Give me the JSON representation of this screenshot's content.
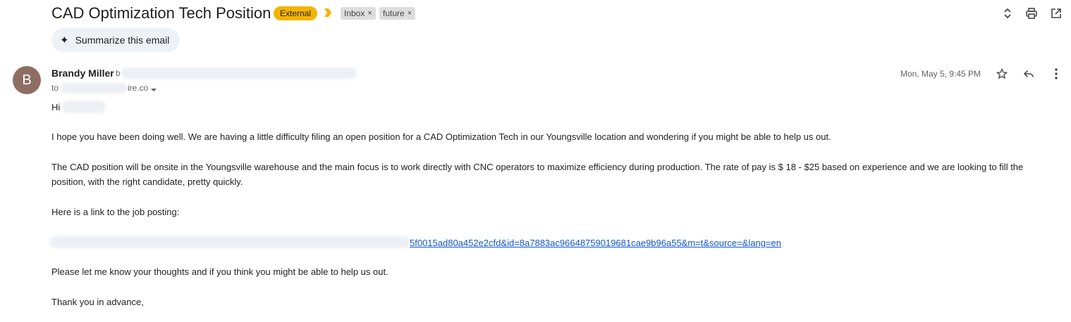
{
  "email": {
    "subject": "CAD Optimization Tech Position",
    "external_badge": "External",
    "labels": [
      {
        "name": "Inbox",
        "remove": "×"
      },
      {
        "name": "future",
        "remove": "×"
      }
    ],
    "summarize_label": "Summarize this email",
    "summarize_glyph": "✦",
    "sender": {
      "avatar_initial": "B",
      "name": "Brandy Miller",
      "email_visible": "b",
      "to_prefix": "to",
      "to_suffix": "ire.co"
    },
    "date": "Mon, May 5, 9:45 PM",
    "greeting": "Hi",
    "paragraphs": [
      "I hope you have been doing well.  We are having a little difficulty filing an open position for a CAD Optimization Tech in our Youngsville location and wondering if you might be able to help us out.",
      "The CAD position will be onsite in the Youngsville warehouse and the main focus is to work directly with CNC operators to maximize efficiency during production.  The rate of pay is $ 18 - $25 based on experience and we are looking to fill the position, with the right candidate, pretty quickly.",
      "Here is a link to the job posting:"
    ],
    "link_visible": "5f0015ad80a452e2cfd&id=8a7883ac96648759019681cae9b96a55&m=t&source=&lang=en",
    "closing_lines": [
      "Please let me know your thoughts and if you think you might be able to help us out.",
      "Thank you in advance,"
    ]
  },
  "colors": {
    "external_badge": "#f4b400",
    "avatar": "#8d6e63",
    "link": "#1155cc",
    "importance_marker": "#f4b400"
  },
  "icons": [
    "importance-marker-icon",
    "expand-collapse-icon",
    "print-icon",
    "open-in-new-window-icon",
    "sparkle-icon",
    "star-icon",
    "reply-icon",
    "more-vert-icon",
    "dropdown-caret-icon"
  ]
}
